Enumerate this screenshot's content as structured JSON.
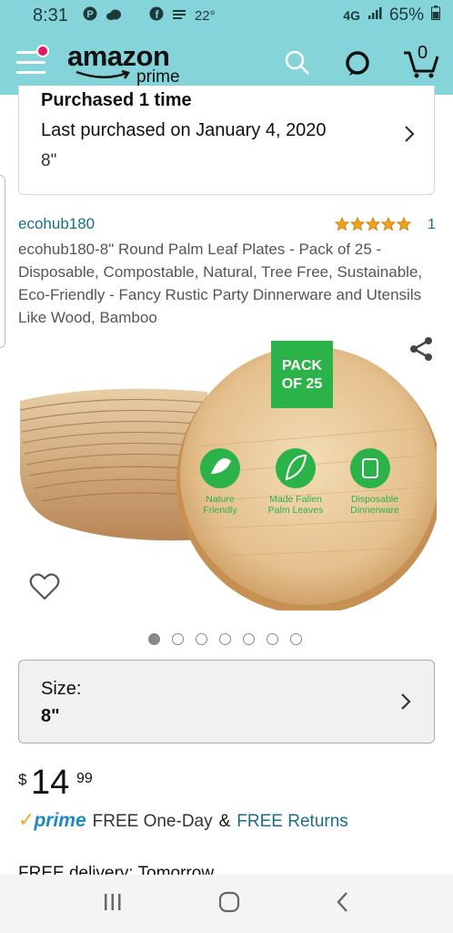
{
  "status_bar": {
    "time": "8:31",
    "temperature": "22°",
    "network": "4G",
    "battery": "65%"
  },
  "header": {
    "logo_text": "amazon",
    "logo_sub": "prime",
    "cart_count": "0"
  },
  "previous_purchase": {
    "purchased_times": "Purchased 1 time",
    "last_purchased": "Last purchased on January 4, 2020",
    "size": "8\""
  },
  "product": {
    "brand": "ecohub180",
    "rating_count": "1",
    "rating": 5,
    "title": "ecohub180-8\" Round Palm Leaf Plates - Pack of 25 - Disposable, Compostable, Natural, Tree Free, Sustainable, Eco-Friendly - Fancy Rustic Party Dinnerware and Utensils Like Wood, Bamboo",
    "image_badge_line1": "PACK",
    "image_badge_line2": "OF 25",
    "image_features": [
      {
        "line1": "Nature",
        "line2": "Friendly"
      },
      {
        "line1": "Made Fallen",
        "line2": "Palm Leaves"
      },
      {
        "line1": "Disposable",
        "line2": "Dinnerware"
      }
    ],
    "image_count": 7,
    "active_image": 1
  },
  "size_selector": {
    "label": "Size:",
    "value": "8\""
  },
  "price": {
    "symbol": "$",
    "whole": "14",
    "fraction": "99"
  },
  "delivery": {
    "prime_label": "prime",
    "free_one_day": "FREE One-Day",
    "ampersand": "&",
    "free_returns": "FREE Returns",
    "cut_off_text": "FREE delivery: Tomorrow"
  },
  "colors": {
    "header_bg": "#85d4d9",
    "link": "#1a6e8a",
    "star": "#f0a01c",
    "badge_green": "#2bb34a"
  }
}
